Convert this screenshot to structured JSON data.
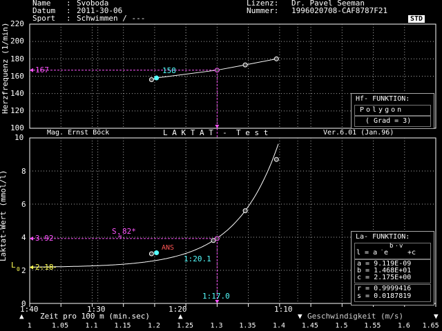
{
  "header": {
    "name_label": "Name",
    "name_value": "Svoboda",
    "datum_label": "Datum",
    "datum_value": "2011-30-06",
    "sport_label": "Sport",
    "sport_value": "Schwimmen / ---",
    "lizenz_label": "Lizenz:",
    "lizenz_value": "Dr. Pavel Seeman",
    "nummer_label": "Nummer:",
    "nummer_value": "1996020708-CAF8787F21",
    "std_badge": "STD"
  },
  "top_chart": {
    "ylabel": "Herzfrequenz (1/min)",
    "yticks": [
      "220",
      "200",
      "180",
      "160",
      "140",
      "120",
      "100"
    ],
    "hf_panel": {
      "title": "Hf- FUNKTION:",
      "type": "Polygon",
      "grad": "( Grad = 3)"
    }
  },
  "middle_bar": {
    "author": "Mag. Ernst Böck",
    "title": "L A K T A T  -  T e s t",
    "version": "Ver.6.01 (Jan.96)"
  },
  "bottom_chart": {
    "ylabel": "Laktat-Wert (mmol/l)",
    "yticks": [
      "10",
      "8",
      "6",
      "4",
      "2",
      "0"
    ],
    "xticks": [
      "1:40",
      "1:30",
      "1:20",
      "1:10"
    ],
    "la_panel": {
      "title": "La- FUNKTION:",
      "formula_left": "l = a",
      "formula_e": "e",
      "formula_exp": "b",
      "formula_exp2": "v",
      "formula_right": "+c",
      "a": "a = 9.119E-09",
      "b": "b = 1.468E+01",
      "c": "c = 2.175E+00",
      "r": "r = 0.9999416",
      "s": "s = 0.0187819"
    }
  },
  "annotations": {
    "hf_167": "167",
    "hf_158": "158",
    "la_392": "3.92",
    "la_218": "2.18",
    "l0_L": "L",
    "l0_sub": "0",
    "s182": "S",
    "s182_sub": "1",
    "s182_val": "82*",
    "ans": "ANS",
    "time_1201": "1:20.1",
    "time_1170": "1:17.0"
  },
  "bottom_axis": {
    "zeit_label": "Zeit pro 100 m (min.sec)",
    "geschw_label": "Geschwindigkeit (m/s)",
    "speed_ticks": [
      "1",
      "1.05",
      "1.1",
      "1.15",
      "1.2",
      "1.25",
      "1.3",
      "1.35",
      "1.4",
      "1.45",
      "1.5",
      "1.55",
      "1.6",
      "1.65"
    ]
  },
  "colors": {
    "magenta": "#ff55ff",
    "cyan": "#55ffff",
    "yellow": "#ffff55",
    "red": "#ff5555",
    "white": "#ffffff"
  },
  "chart_data": [
    {
      "type": "line",
      "ylabel": "Herzfrequenz (1/min)",
      "xunit": "m/s",
      "ylim": [
        100,
        220
      ],
      "xlim": [
        1,
        1.65
      ],
      "grid": true,
      "x": [
        1.195,
        1.203,
        1.3,
        1.345,
        1.395
      ],
      "y": [
        156,
        158,
        167,
        173,
        180
      ]
    },
    {
      "type": "line",
      "ylabel": "Laktat-Wert (mmol/l)",
      "xlabel": "Zeit pro 100 m (min.sec)",
      "ylim": [
        0,
        10
      ],
      "xlim": [
        1,
        1.65
      ],
      "grid": true,
      "x": [
        1.195,
        1.203,
        1.294,
        1.3,
        1.345,
        1.395
      ],
      "y": [
        3.0,
        3.06,
        3.8,
        3.92,
        5.6,
        8.7
      ],
      "fit": {
        "a": 9.119e-09,
        "b": 14.68,
        "c": 2.175
      }
    }
  ]
}
